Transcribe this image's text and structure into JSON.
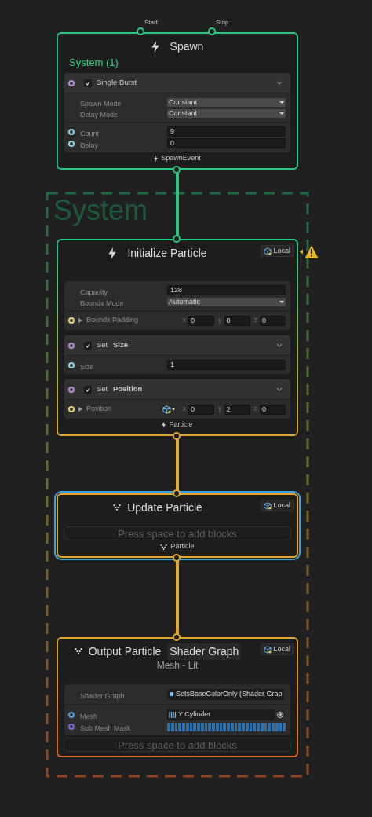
{
  "group": {
    "title": "System"
  },
  "nodes": [
    {
      "kind": "spawn",
      "title": "Spawn",
      "selected": false,
      "system_name": "System (1)",
      "inputs": [
        {
          "label": "Start"
        },
        {
          "label": "Stop"
        }
      ],
      "blocks": [
        {
          "title": "Single Burst",
          "checked": true,
          "expanded": true,
          "color": "#b38fd6",
          "sections": [
            [
              {
                "kind": "dropdown",
                "label": "Spawn Mode",
                "value": "Constant"
              },
              {
                "kind": "dropdown",
                "label": "Delay Mode",
                "value": "Constant"
              }
            ],
            [
              {
                "kind": "field",
                "label": "Count",
                "value": "9",
                "color": "#8fd3e0"
              },
              {
                "kind": "field",
                "label": "Delay",
                "value": "0",
                "color": "#8fd3e0"
              }
            ]
          ]
        }
      ],
      "output": "SpawnEvent"
    },
    {
      "kind": "initialize",
      "title": "Initialize Particle",
      "selected": false,
      "badge": "Local",
      "warning": true,
      "blocks": [
        {
          "sections": [
            [
              {
                "kind": "field",
                "label": "Capacity",
                "value": "128"
              },
              {
                "kind": "dropdown",
                "label": "Bounds Mode",
                "value": "Automatic"
              }
            ],
            [
              {
                "kind": "vector",
                "label": "Bounds Padding",
                "color": "#e3d26f",
                "expanded": false,
                "components": [
                  {
                    "axis": "x",
                    "value": "0"
                  },
                  {
                    "axis": "y",
                    "value": "0"
                  },
                  {
                    "axis": "z",
                    "value": "0"
                  }
                ]
              }
            ]
          ]
        },
        {
          "title": "Set **Size**",
          "checked": true,
          "expanded": true,
          "color": "#b38fd6",
          "sections": [
            [
              {
                "kind": "field",
                "label": "Size",
                "value": "1",
                "color": "#8fd3e0"
              }
            ]
          ]
        },
        {
          "title": "Set **Position**",
          "checked": true,
          "expanded": true,
          "color": "#b38fd6",
          "sections": [
            [
              {
                "kind": "vector",
                "label": "Position",
                "color": "#e3d26f",
                "expanded": false,
                "space": true,
                "components": [
                  {
                    "axis": "x",
                    "value": "0"
                  },
                  {
                    "axis": "y",
                    "value": "2"
                  },
                  {
                    "axis": "z",
                    "value": "0"
                  }
                ]
              }
            ]
          ]
        }
      ],
      "output": "Particle"
    },
    {
      "kind": "update",
      "title": "Update Particle",
      "selected": true,
      "badge": "Local",
      "placeholder": "Press space to add blocks",
      "output": "Particle"
    },
    {
      "kind": "output",
      "title": "Output Particle",
      "tag": "Shader Graph",
      "subtitle": "Mesh - Lit",
      "selected": false,
      "badge": "Local",
      "blocks": [
        {
          "sections": [
            [
              {
                "kind": "shader_object",
                "label": "Shader Graph",
                "value": "SetsBaseColorOnly (Shader Grap"
              }
            ],
            [
              {
                "kind": "mesh_object",
                "label": "Mesh",
                "value": "Y Cylinder",
                "color": "#5c9ed6"
              },
              {
                "kind": "mask",
                "label": "Sub Mesh Mask",
                "color": "#7b68d9"
              }
            ]
          ]
        }
      ],
      "placeholder": "Press space to add blocks"
    }
  ]
}
